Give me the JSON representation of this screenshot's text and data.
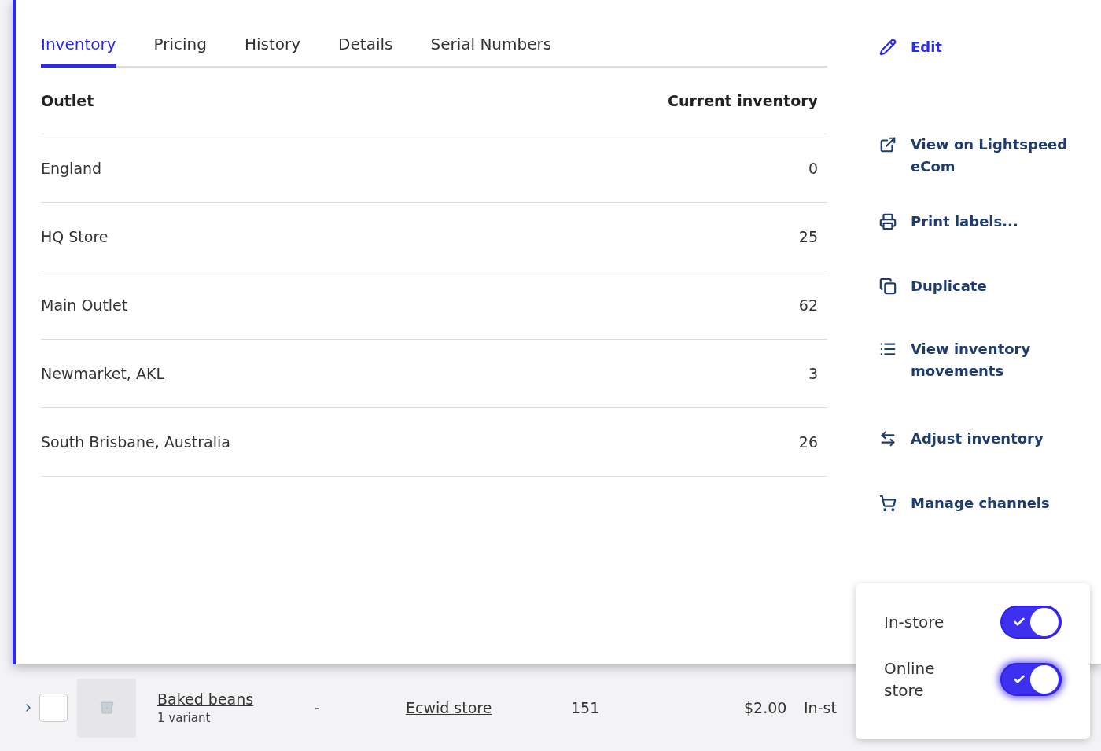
{
  "tabs": [
    {
      "label": "Inventory",
      "selected": true
    },
    {
      "label": "Pricing",
      "selected": false
    },
    {
      "label": "History",
      "selected": false
    },
    {
      "label": "Details",
      "selected": false
    },
    {
      "label": "Serial Numbers",
      "selected": false
    }
  ],
  "table": {
    "columns": [
      "Outlet",
      "Current inventory"
    ],
    "rows": [
      {
        "outlet": "England",
        "inventory": "0"
      },
      {
        "outlet": "HQ Store",
        "inventory": "25"
      },
      {
        "outlet": "Main Outlet",
        "inventory": "62"
      },
      {
        "outlet": "Newmarket, AKL",
        "inventory": "3"
      },
      {
        "outlet": "South Brisbane, Australia",
        "inventory": "26"
      }
    ]
  },
  "actions": [
    {
      "kind": "edit",
      "label": "Edit"
    },
    {
      "kind": "external",
      "label": "View on Lightspeed eCom"
    },
    {
      "kind": "print",
      "label": "Print labels..."
    },
    {
      "kind": "duplicate",
      "label": "Duplicate"
    },
    {
      "kind": "list",
      "label": "View inventory movements"
    },
    {
      "kind": "adjust",
      "label": "Adjust inventory"
    },
    {
      "kind": "channels",
      "label": "Manage channels"
    }
  ],
  "product_row": {
    "expanded": false,
    "checked": false,
    "name": "Baked beans",
    "variants": "1 variant",
    "column_3": "-",
    "channel": "Ecwid store",
    "column_5": "151",
    "price": "$2.00",
    "column_7": "In-st"
  },
  "channels_popover": {
    "channels": [
      {
        "label": "In-store",
        "on": true,
        "focused": false
      },
      {
        "label": "Online store",
        "on": true,
        "focused": true
      }
    ]
  }
}
